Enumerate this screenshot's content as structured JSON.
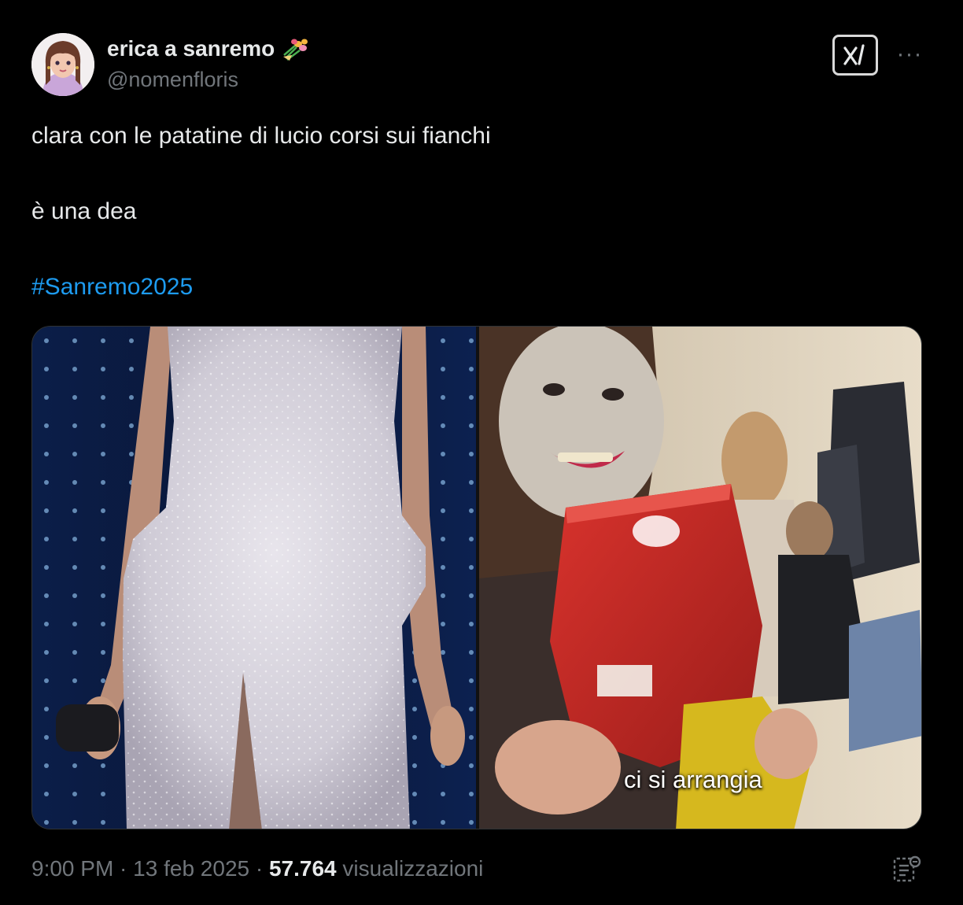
{
  "author": {
    "display_name": "erica a sanremo",
    "name_emoji_icon": "bouquet-icon",
    "handle": "@nomenfloris"
  },
  "header": {
    "grok_icon": "grok-icon",
    "more_icon": "more-icon",
    "more_label": "···"
  },
  "post": {
    "line1": "clara con le patatine di lucio corsi sui fianchi",
    "line2": "è una dea",
    "hashtag": "#Sanremo2025"
  },
  "media": {
    "right_caption": "ci si arrangia"
  },
  "footer": {
    "time": "9:00 PM",
    "separator": " · ",
    "date": "13 feb 2025",
    "views_count": "57.764",
    "views_label": " visualizzazioni",
    "analytics_icon": "analytics-icon"
  },
  "colors": {
    "background": "#000000",
    "text": "#e7e9ea",
    "secondary": "#71767b",
    "link": "#1d9bf0"
  }
}
